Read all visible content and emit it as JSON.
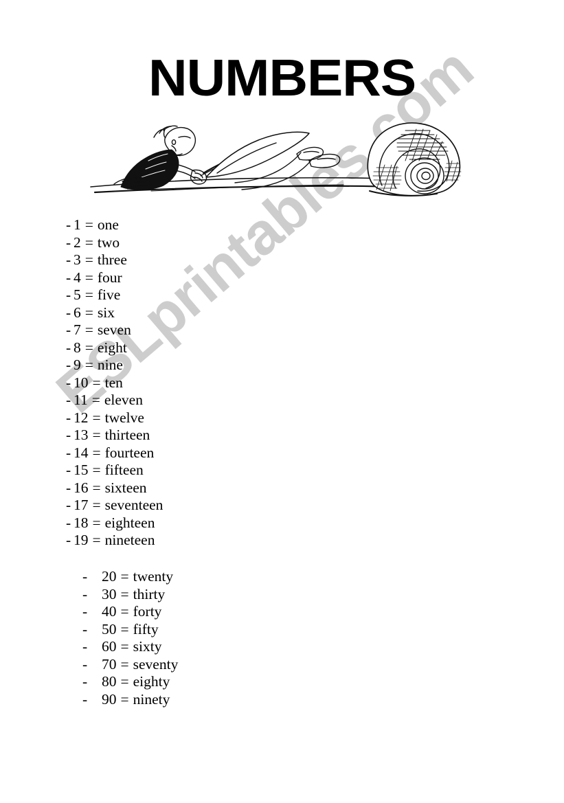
{
  "document": {
    "title": "NUMBERS",
    "watermark": "ESLprintables.com",
    "watermark_color": "#cdcdcd",
    "text_color": "#000000",
    "background_color": "#ffffff"
  },
  "illustration": {
    "name": "man-writing-on-long-unrolled-scroll",
    "description": "Cartoon line drawing of a man lying on the floor writing with a pen on a very long sheet of paper that unrolls to the right into a large cross-hatched paper roll."
  },
  "lists": {
    "units": {
      "separator": "=",
      "bullet": "-",
      "items": [
        {
          "digits": "1",
          "word": "one"
        },
        {
          "digits": "2",
          "word": "two"
        },
        {
          "digits": "3",
          "word": "three"
        },
        {
          "digits": "4",
          "word": "four"
        },
        {
          "digits": "5",
          "word": "five"
        },
        {
          "digits": "6",
          "word": "six"
        },
        {
          "digits": "7",
          "word": "seven"
        },
        {
          "digits": "8",
          "word": "eight"
        },
        {
          "digits": "9",
          "word": "nine"
        },
        {
          "digits": "10",
          "word": "ten"
        },
        {
          "digits": "11",
          "word": "eleven"
        },
        {
          "digits": "12",
          "word": "twelve"
        },
        {
          "digits": "13",
          "word": "thirteen"
        },
        {
          "digits": "14",
          "word": "fourteen"
        },
        {
          "digits": "15",
          "word": "fifteen"
        },
        {
          "digits": "16",
          "word": "sixteen"
        },
        {
          "digits": "17",
          "word": "seventeen"
        },
        {
          "digits": "18",
          "word": "eighteen"
        },
        {
          "digits": "19",
          "word": "nineteen"
        }
      ]
    },
    "tens": {
      "separator": "=",
      "bullet": "-",
      "items": [
        {
          "digits": "20",
          "word": "twenty"
        },
        {
          "digits": "30",
          "word": "thirty"
        },
        {
          "digits": "40",
          "word": "forty"
        },
        {
          "digits": "50",
          "word": "fifty"
        },
        {
          "digits": "60",
          "word": "sixty"
        },
        {
          "digits": "70",
          "word": "seventy"
        },
        {
          "digits": "80",
          "word": "eighty"
        },
        {
          "digits": "90",
          "word": "ninety"
        }
      ]
    }
  }
}
